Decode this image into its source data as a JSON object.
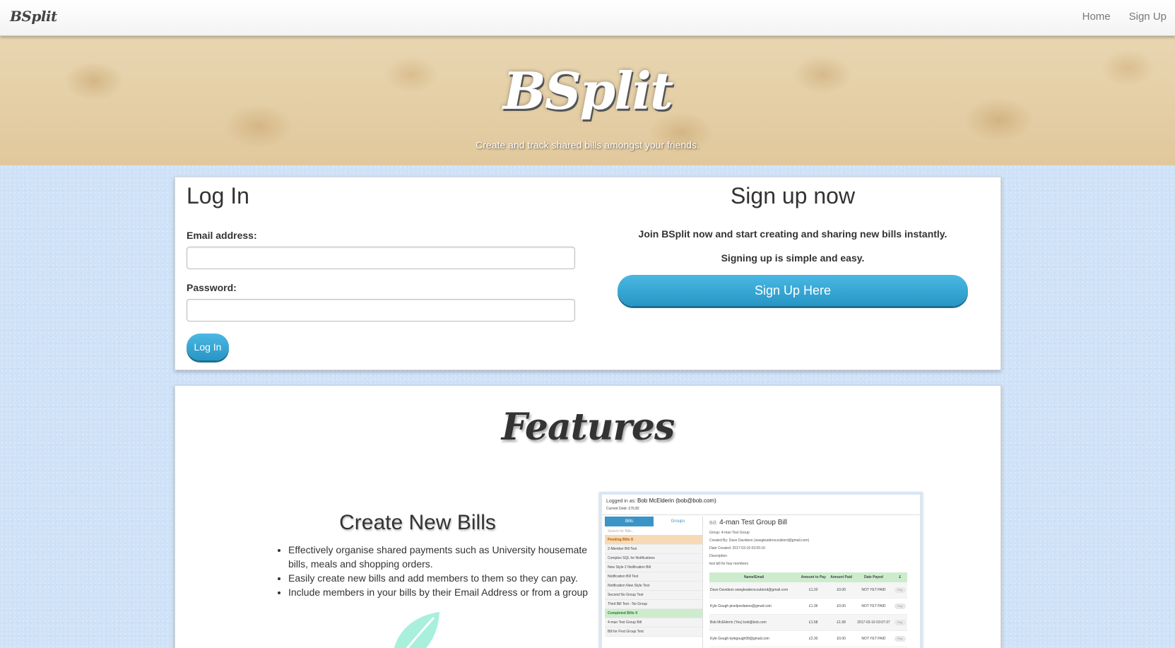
{
  "navbar": {
    "brand": "BSplit",
    "links": [
      "Home",
      "Sign Up"
    ]
  },
  "hero": {
    "title": "BSplit",
    "tagline": "Create and track shared bills amongst your friends."
  },
  "login": {
    "title": "Log In",
    "email_label": "Email address:",
    "email_value": "",
    "password_label": "Password:",
    "password_value": "",
    "button": "Log In"
  },
  "signup": {
    "title": "Sign up now",
    "text1": "Join BSplit now and start creating and sharing new bills instantly.",
    "text2": "Signing up is simple and easy.",
    "button": "Sign Up Here"
  },
  "features": {
    "title": "Features",
    "heading": "Create New Bills",
    "bullets": [
      "Effectively organise shared payments such as University housemate bills, meals and shopping orders.",
      "Easily create new bills and add members to them so they can pay.",
      "Include members in your bills by their Email Address or from a group"
    ]
  },
  "screenshot": {
    "logged_in_label": "Logged in as:",
    "logged_in_user": "Bob McElderin (bob@bob.com)",
    "credit_label": "Current Debt: £76.82",
    "tabs": [
      "Bills",
      "Groups"
    ],
    "search_placeholder": "Search for Bills...",
    "pending_section": "Pending Bills",
    "pending_count": "8",
    "pending_items": [
      "2-Member Bill Test",
      "Complex SQL for Notifications",
      "New Style 2 Notification Bill",
      "Notification Bill Test",
      "Notification New Style Test",
      "Second No Group Test",
      "Third Bill Test - No Group"
    ],
    "completed_section": "Completed Bills",
    "completed_count": "9",
    "completed_items": [
      "4-man Test Group Bill",
      "Bill for First Group Test"
    ],
    "bill_label": "Bill:",
    "bill_title": "4-man Test Group Bill",
    "meta": [
      "Group: 4-man Test Group",
      "Created By: Dave Davidson (swegleadersczubiord@gmail.com)",
      "Date Created: 2017-03-16 03:05:16",
      "Description",
      "test bill for four members"
    ],
    "table_headers": [
      "Name/Email",
      "Amount to Pay",
      "Amount Paid",
      "Date Payed",
      "£"
    ],
    "table_rows": [
      [
        "Dave Davidson swegleadersczubiord@gmail.com",
        "£1.20",
        "£0.00",
        "NOT YET PAID",
        "Pay"
      ],
      [
        "Kyle Gough pixelpredators@gmail.com",
        "£1.36",
        "£0.00",
        "NOT YET PAID",
        "Pay"
      ],
      [
        "Bob McElderin (You) bob@bob.com",
        "£1.58",
        "£1.58",
        "2017-03-16 03:07:37",
        "Pay"
      ],
      [
        "Kyle Gough kylegough99@gmail.com",
        "£2.30",
        "£0.00",
        "NOT YET PAID",
        "Pay"
      ]
    ]
  },
  "colors": {
    "accent": "#2b9fd0",
    "background": "#cfe2f7",
    "hero": "#e5cfa6"
  }
}
